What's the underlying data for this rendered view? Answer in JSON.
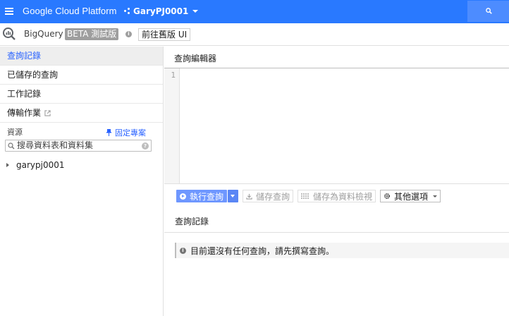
{
  "topbar": {
    "app_title": "Google Cloud Platform",
    "project_name": "GaryPJ0001",
    "accent_color": "#2979ff"
  },
  "appbar": {
    "product_name": "BigQuery",
    "beta_label": "BETA 測試版",
    "classic_ui_label": "前往舊版 UI"
  },
  "sidebar": {
    "items": [
      {
        "label": "查詢記錄",
        "active": true
      },
      {
        "label": "已儲存的查詢",
        "active": false
      },
      {
        "label": "工作記錄",
        "active": false
      },
      {
        "label": "傳輸作業",
        "active": false,
        "external": true
      }
    ],
    "resources_label": "資源",
    "pin_project_label": "固定專案",
    "search_placeholder": "搜尋資料表和資料集",
    "tree": [
      {
        "label": "garypj0001",
        "expanded": false
      }
    ]
  },
  "editor": {
    "title": "查詢編輯器",
    "line_numbers": [
      "1"
    ],
    "content": ""
  },
  "toolbar": {
    "run_label": "執行查詢",
    "save_label": "儲存查詢",
    "save_view_label": "儲存為資料檢視",
    "more_label": "其他選項"
  },
  "history": {
    "title": "查詢記錄",
    "empty_message": "目前還沒有任何查詢，請先撰寫查詢。"
  }
}
